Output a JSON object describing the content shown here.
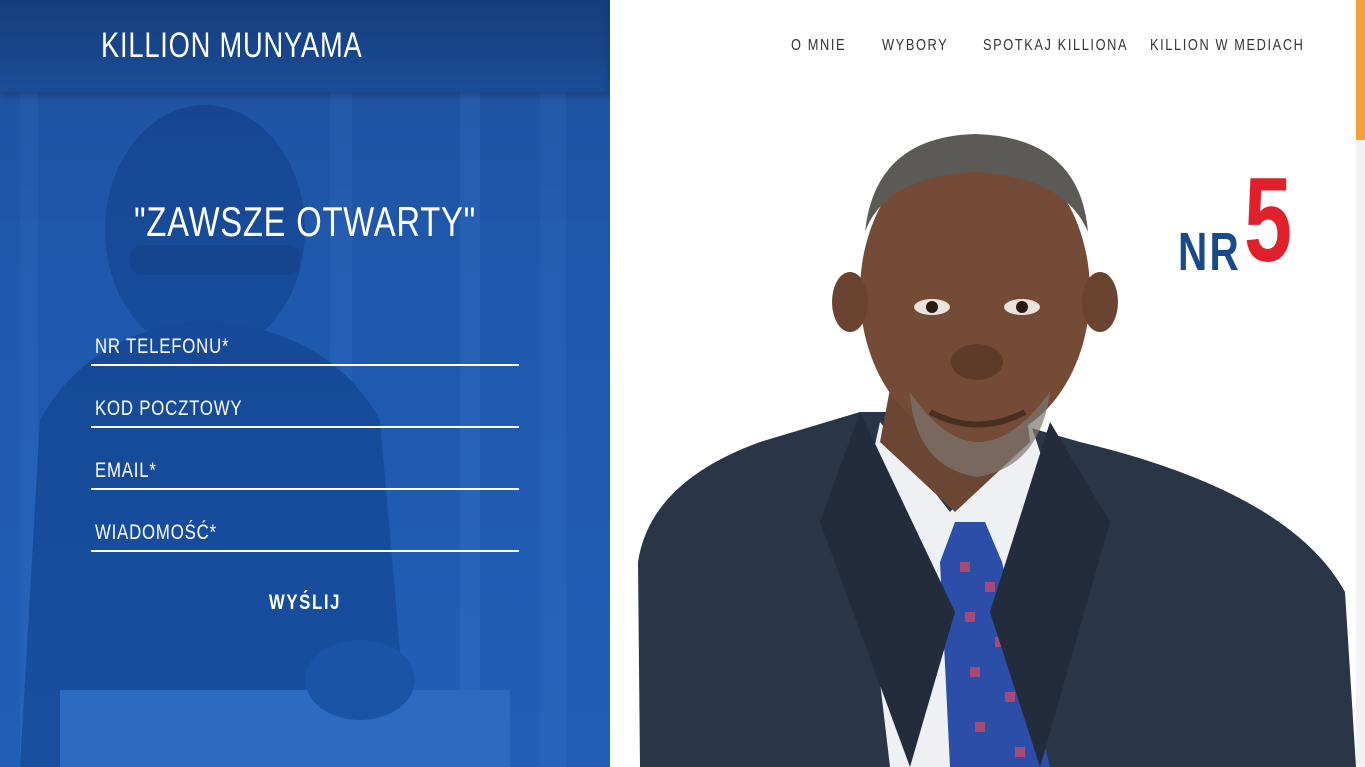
{
  "brand": "KILLION MUNYAMA",
  "nav": [
    "O MNIE",
    "WYBORY",
    "SPOTKAJ KILLIONA",
    "KILLION W MEDIACH"
  ],
  "form": {
    "title": "\"ZAWSZE OTWARTY\"",
    "fields": [
      {
        "label": "NR TELEFONU*",
        "value": ""
      },
      {
        "label": "KOD POCZTOWY",
        "value": ""
      },
      {
        "label": "EMAIL*",
        "value": ""
      },
      {
        "label": "WIADOMOŚĆ*",
        "value": ""
      }
    ],
    "submit_label": "WYŚLIJ"
  },
  "badge": {
    "prefix": "NR",
    "number": "5"
  },
  "colors": {
    "panel_blue": "#1a56ad",
    "header_blue": "#163e7d",
    "badge_blue": "#1a4a8c",
    "badge_red": "#e0202a",
    "scroll_accent": "#f5a03a"
  }
}
